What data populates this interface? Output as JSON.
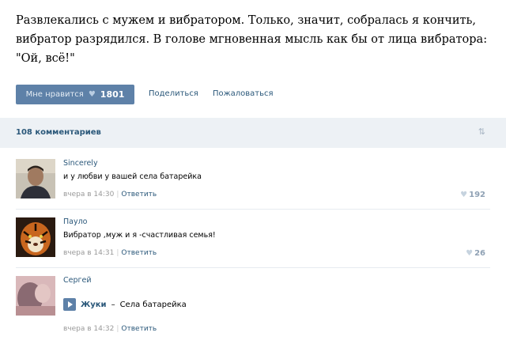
{
  "post": {
    "text": "Развлекались с мужем и вибратором. Только, значит, собралась я кончить, вибратор разрядился. В голове мгновенная мысль как бы от лица вибратора: \"Ой, всё!\"",
    "like_label": "Мне нравится",
    "like_count": "1801",
    "share_label": "Поделиться",
    "report_label": "Пожаловаться"
  },
  "comments_header": {
    "count_label": "108 комментариев",
    "sort_icon": "sort-arrows-icon"
  },
  "comments": [
    {
      "author": "Sincerely",
      "text": "и у любви у вашей села батарейка",
      "time": "вчера в 14:30",
      "reply_label": "Ответить",
      "likes": "192"
    },
    {
      "author": "Пауло",
      "text": "Вибратор ,муж и я -счастливая семья!",
      "time": "вчера в 14:31",
      "reply_label": "Ответить",
      "likes": "26"
    },
    {
      "author": "Сергей",
      "audio_artist": "Жуки",
      "audio_title": "Села батарейка",
      "audio_dash": "–",
      "time": "вчера в 14:32",
      "reply_label": "Ответить"
    }
  ],
  "colors": {
    "accent": "#5e81a8",
    "link": "#2b587a",
    "header_bg": "#edf1f5"
  }
}
